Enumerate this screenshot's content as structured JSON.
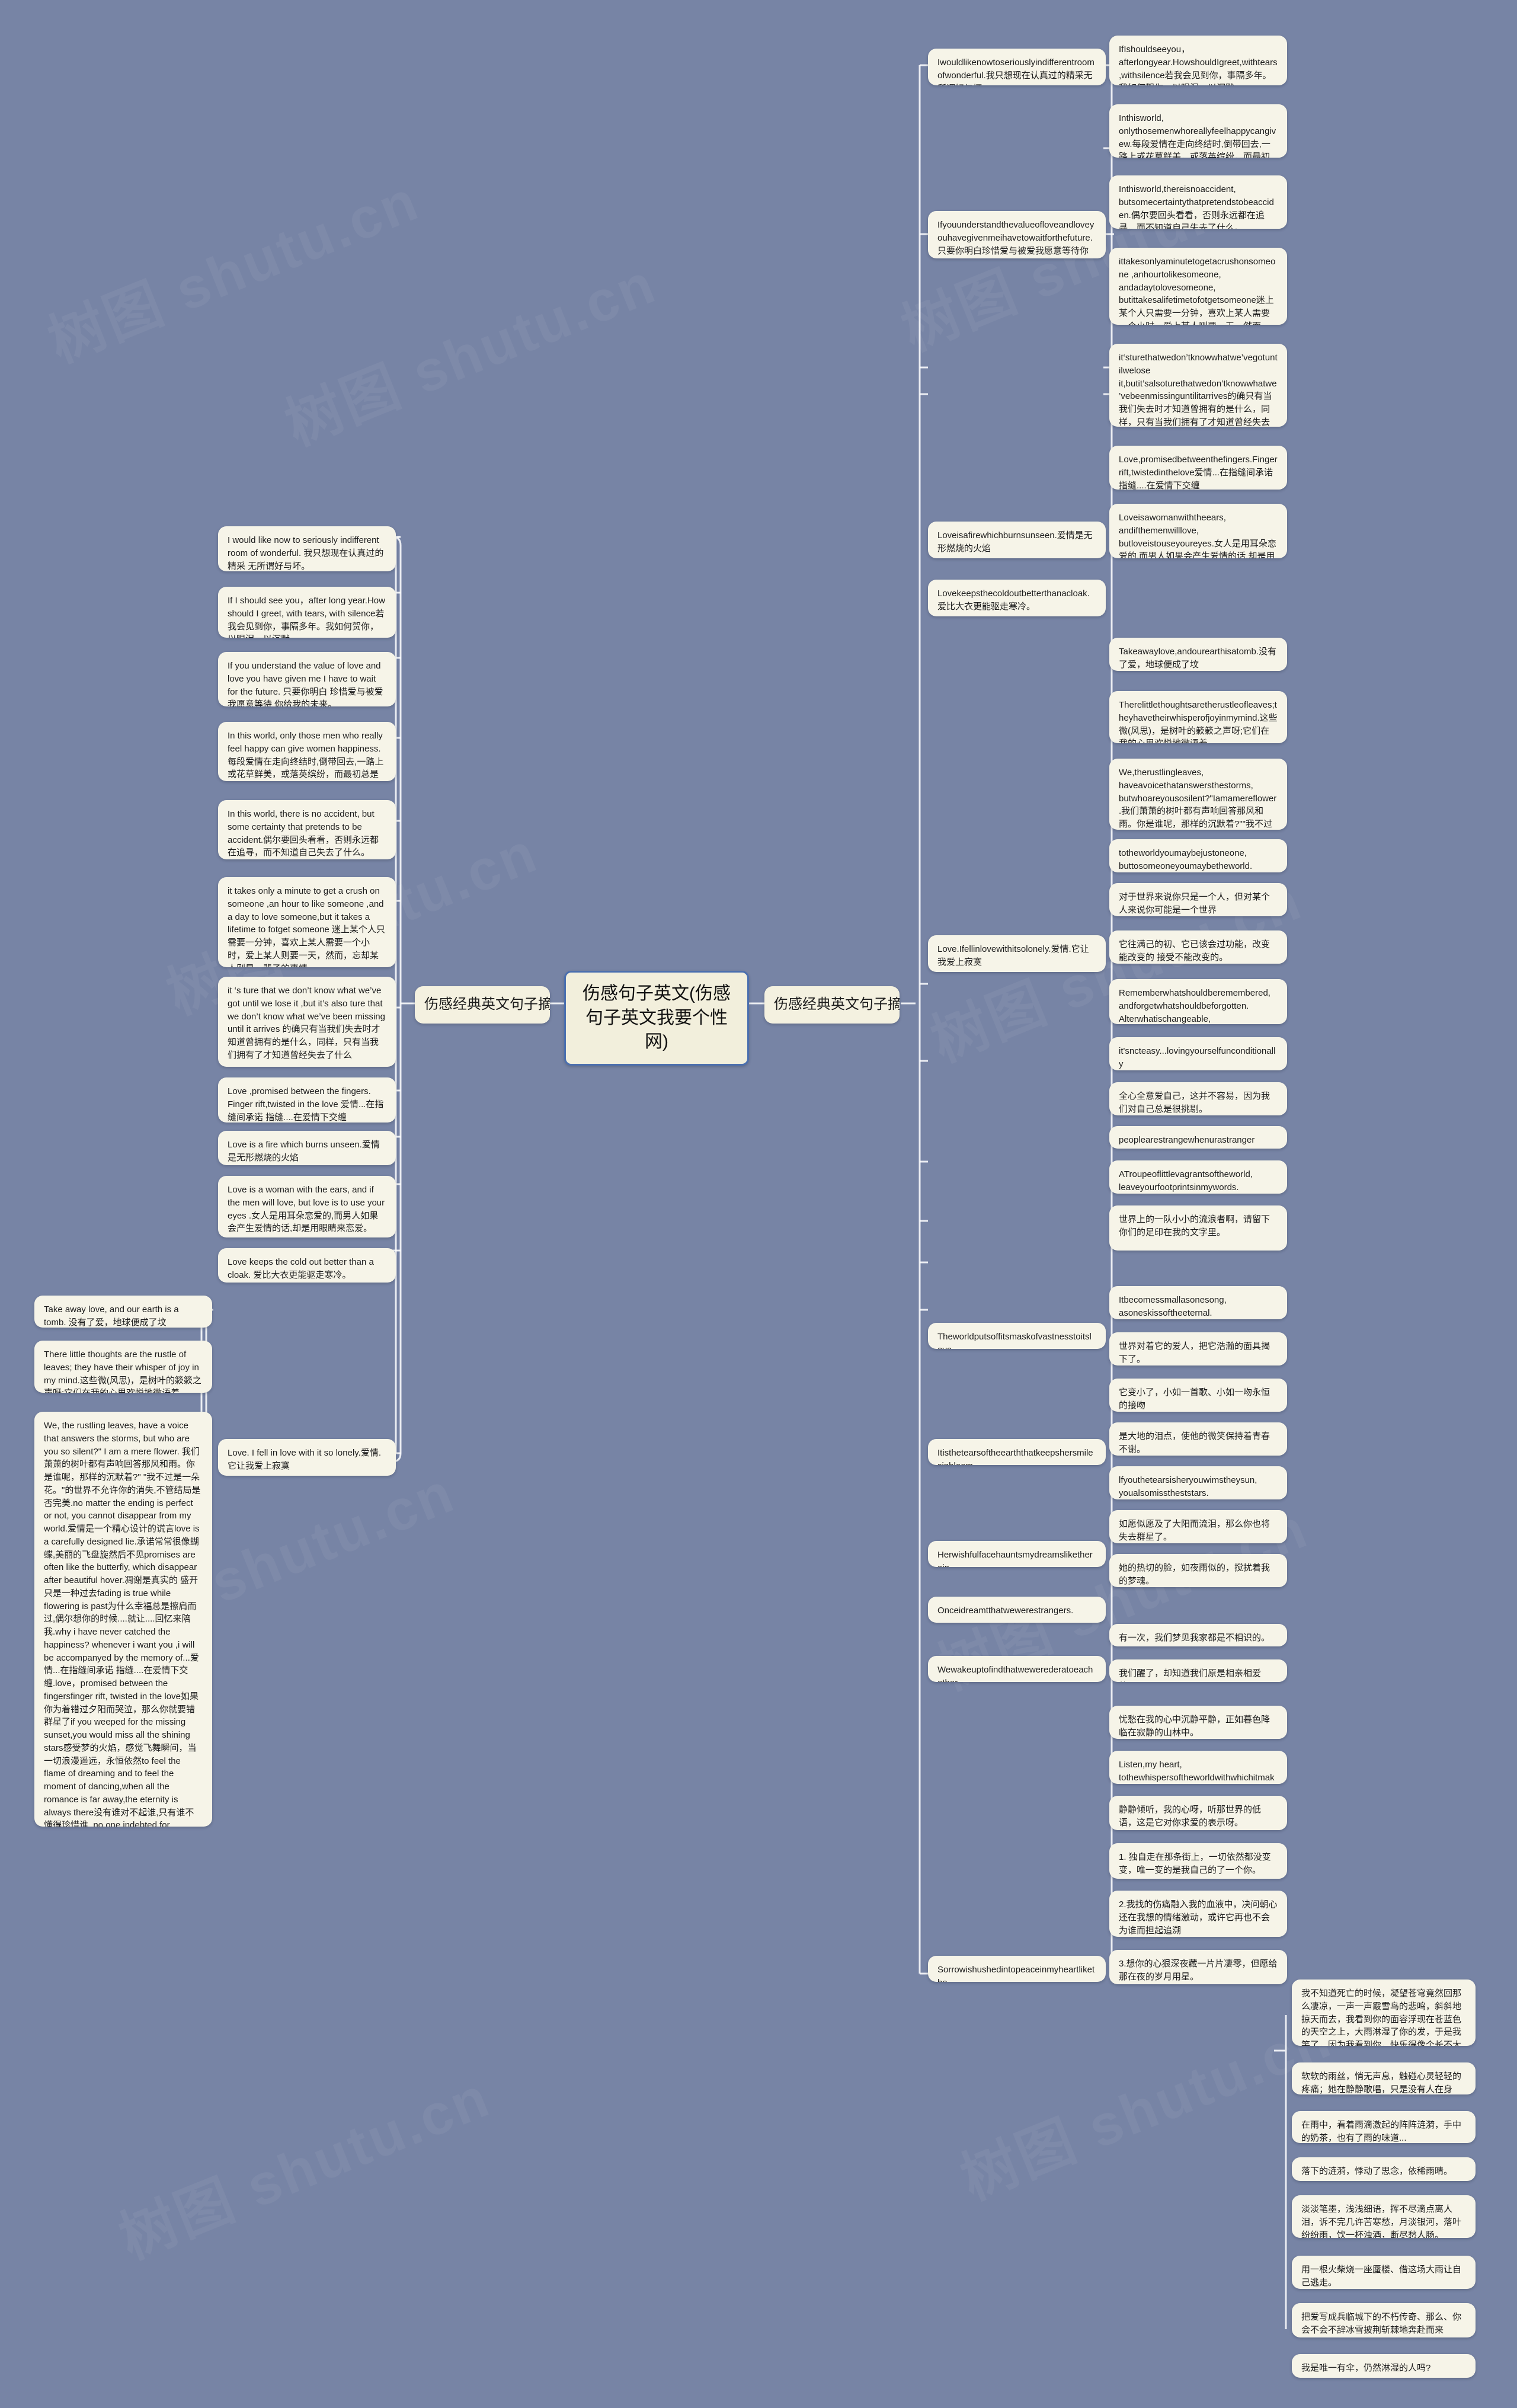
{
  "root": {
    "title": "伤感句子英文(伤感句子英文我要个性网)"
  },
  "branches": {
    "left_label": "伤感经典英文句子摘录：",
    "right_label": "伤感经典英文句子摘录："
  },
  "left_column": [
    {
      "text": "I would like now to seriously indifferent room of wonderful. 我只想现在认真过的精采 无所谓好与坏。"
    },
    {
      "text": "If I should see you，after long year.How should I greet, with tears, with silence若我会见到你，事隔多年。我如何贺你，以眼泪，以沉默。"
    },
    {
      "text": "If you understand the value of love and love you have given me I have to wait for the future. 只要你明白 珍惜爱与被爱 我愿意等待 你给我的未来。"
    },
    {
      "text": "In this world, only those men who really feel happy can give women happiness.每段爱情在走向终结时,倒带回去,一路上或花草鲜美，或落英缤纷，而最初总是倾心的。"
    },
    {
      "text": "In this world, there is no accident, but some certainty that pretends to be accident.偶尔要回头看看，否则永远都在追寻，而不知道自己失去了什么。"
    },
    {
      "text": "it takes only a minute to get a crush on someone ,an hour to like someone ,and a day to love someone,but it takes a lifetime to fotget someone 迷上某个人只需要一分钟，喜欢上某人需要一个小时，爱上某人则要一天，然而，忘却某人则是一辈子的事情"
    },
    {
      "text": "it ‘s ture that we don’t know what we’ve got until we lose it ,but it’s also ture that we don’t know what we’ve been missing until it arrives 的确只有当我们失去时才知道曾拥有的是什么，同样，只有当我们拥有了才知道曾经失去了什么"
    },
    {
      "text": "Love ,promised between the fingers. Finger rift,twisted in the love 爱情...在指缝间承诺 指缝....在爱情下交缠"
    },
    {
      "text": "Love is a fire which burns unseen.爱情是无形燃烧的火焰"
    },
    {
      "text": "Love is a woman with the ears, and if the men will love, but love is to use your eyes .女人是用耳朵恋爱的,而男人如果会产生爱情的话,却是用眼睛来恋爱。"
    },
    {
      "text": "Love keeps the cold out better than a cloak. 爱比大衣更能驱走寒冷。"
    },
    {
      "text": "Love. I fell in love with it so lonely.爱情.它让我爱上寂寞"
    }
  ],
  "far_left_column": [
    {
      "text": "Take away love, and our earth is a tomb. 没有了爱，地球便成了坟"
    },
    {
      "text": "There little thoughts are the rustle of leaves; they have their whisper of joy in my mind.这些微(风思)，是树叶的簌簌之声呀;它们在我的心里欢悦地微语着。"
    },
    {
      "text": "We, the rustling leaves, have a voice that answers the storms, but who are you so silent?\" I am a mere flower. 我们萧萧的树叶都有声响回答那风和雨。你是谁呢，那样的沉默着?\" \"我不过是一朵花。\"的世界不允许你的消失,不管结局是否完美.no matter the ending is perfect or not, you cannot disappear from my world.爱情是一个精心设计的谎言love is a carefully designed lie.承诺常常很像蝴蝶,美丽的飞盘旋然后不见promises are often like the butterfly, which disappear after beautiful hover.凋谢是真实的 盛开只是一种过去fading is true while flowering is past为什么幸福总是擦肩而过,偶尔想你的时候....就让....回忆来陪我.why i have never catched the happiness? whenever i want you ,i will be accompanyed by the memory of...爱情...在指缝间承诺 指缝....在爱情下交缠.love，promised between the fingersfinger rift, twisted in the love如果你为着错过夕阳而哭泣，那么你就要错群星了if you weeped for the missing sunset,you would miss all the shining stars感受梦的火焰，感觉飞舞瞬间，当一切浪漫遥远，永恒依然to feel the flame of dreaming and to feel the moment of dancing,when all the romance is far away,the eternity is always there没有谁对不起谁,只有谁不懂得珍惜谁. no one indebted for others,while many people don't know how to cherish others.永远不是一种距离,而是一种决定。 eternity is not a distance but a decision.在回忆里继续梦幻不如在地狱里等待天堂dreaming in the memory is not as good as waiting for the paradise in the hellwhere there is great love, there are always miracles"
    }
  ],
  "right_mid_column": [
    {
      "text": "Iwouldlikenowtoseriouslyindifferentroomofwonderful.我只想现在认真过的精采无所谓好与坏。"
    },
    {
      "text": "Ifyouunderstandthevalueofloveandloveyouhavegivenmeihavetowaitforthefuture.只要你明白珍惜爱与被爱我愿意等待你给我的未来。"
    },
    {
      "text": "Loveisafirewhichburnsunseen.爱情是无形燃烧的火焰"
    },
    {
      "text": "Lovekeepsthecoldoutbetterthanacloak.爱比大衣更能驱走寒冷。"
    },
    {
      "text": "Love.Ifellinlovewithitsolonely.爱情.它让我爱上寂寞"
    },
    {
      "text": "Theworldputsoffitsmaskofvastnesstoitslove."
    },
    {
      "text": "Itisthetearsoftheearththatkeepshersmilesinbloom."
    },
    {
      "text": "Herwishfulfacehauntsmydreamsliketherain."
    },
    {
      "text": "Onceidreamtthatwewerestrangers."
    },
    {
      "text": "Wewakeuptofindthatwewerederatoeachother."
    },
    {
      "text": "Sorrowishushedintopeaceinmyheartlikethe"
    }
  ],
  "right_far_column": [
    {
      "text": "IfIshouldseeyou，afterlongyear.HowshouldIgreet,withtears,withsilence若我会见到你，事隔多年。我如何贺你，以眼泪，以沉默。"
    },
    {
      "text": "Inthisworld, onlythosemenwhoreallyfeelhappycangivew.每段爱情在走向终结时,倒带回去,一路上或花草鲜美，或落英缤纷，而最初总是倾心的。"
    },
    {
      "text": "Inthisworld,thereisnoaccident, butsomecertaintythatpretendstobeacciden.偶尔要回头看看，否则永远都在追寻，而不知道自己失去了什么。"
    },
    {
      "text": "ittakesonlyaminutetogetacrushonsomeone ,anhourtolikesomeone, andadaytolovesomeone, butittakesalifetimetofotgetsomeone迷上某个人只需要一分钟，喜欢上某人需要一个小时，爱上某人则要一天，然而，忘却某人则是一辈子的事情"
    },
    {
      "text": "it‘sturethatwedon’tknowwhatwe’vegotuntilwelose it,butit’salsoturethatwedon’tknowwhatwe’vebeenmissinguntilitarrives的确只有当我们失去时才知道曾拥有的是什么，同样，只有当我们拥有了才知道曾经失去了什么"
    },
    {
      "text": "Love,promisedbetweenthefingers.Fingerrift,twistedinthelove爱情...在指缝间承诺 指缝....在爱情下交缠"
    },
    {
      "text": "Loveisawomanwiththeears, andifthemenwilllove, butloveistouseyoureyes.女人是用耳朵恋爱的,而男人如果会产生爱情的话,却是用眼睛来恋爱。"
    },
    {
      "text": "Takeawaylove,andourearthisatomb.没有了爱，地球便成了坟"
    },
    {
      "text": "Therelittlethoughtsaretherustleofleaves;theyhavetheirwhisperofjoyinmymind.这些微(风思)，是树叶的簌簌之声呀;它们在我的心里欢悦地微语着。"
    },
    {
      "text": "We,therustlingleaves, haveavoicethatanswersthestorms, butwhoareyousosilent?\"Iamamereflower.我们萧萧的树叶都有声响回答那风和雨。你是谁呢，那样的沉默着?\"\"我不过是一朵花。\""
    },
    {
      "text": "totheworldyoumaybejustoneone, buttosomeoneyoumaybetheworld."
    },
    {
      "text": "对于世界来说你只是一个人，但对某个人来说你可能是一个世界"
    },
    {
      "text": "它往满己的初、它已该会过功能，改变能改变的 接受不能改变的。"
    },
    {
      "text": "Rememberwhatshouldberemembered, andforgetwhatshouldbeforgotten. Alterwhatischangeable, andacceptwhatisimmutable."
    },
    {
      "text": "it'sncteasy...lovingyourselfunconditionally ,becausewe'velearnedtojudgeourselves..."
    },
    {
      "text": "全心全意爱自己，这并不容易，因为我们对自己总是很挑剔。"
    },
    {
      "text": "peoplearestrangewhenurastranger"
    },
    {
      "text": "ATroupeoflittlevagrantsoftheworld, leaveyourfootprintsinmywords."
    },
    {
      "text": "世界上的一队小小的流浪者啊，请留下你们的足印在我的文字里。"
    },
    {
      "text": "Itbecomessmallasonesong, asoneskissoftheeternal."
    },
    {
      "text": "世界对着它的爱人，把它浩瀚的面具揭下了。"
    },
    {
      "text": "它变小了，小如一首歌、小如一吻永恒的接吻"
    },
    {
      "text": "是大地的泪点，使他的微笑保持着青春不谢。"
    },
    {
      "text": "lfyouthetearsisheryouwimstheysun, youalsomisstheststars."
    },
    {
      "text": "如愿似愿及了大阳而流泪，那么你也将失去群星了。"
    },
    {
      "text": "她的热切的脸，如夜雨似的，搅扰着我的梦魂。"
    },
    {
      "text": "有一次，我们梦见我家都是不相识的。"
    },
    {
      "text": "我们醒了，却知道我们原是相亲相爱的。"
    },
    {
      "text": "忧愁在我的心中沉静平静，正如暮色降临在寂静的山林中。"
    },
    {
      "text": "Listen,my heart, tothewhispersoftheworldwithwhichitmakes"
    },
    {
      "text": "静静倾听，我的心呀，听那世界的低语，这是它对你求爱的表示呀。"
    },
    {
      "text": "1. 独自走在那条街上，一切依然都没变变，唯一变的是我自己的了一个你。"
    },
    {
      "text": "2.我找的伤痛融入我的血液中，决问朝心还在我想的情绪激动，或许它再也不会为谁而担起追溯"
    },
    {
      "text": "3.想你的心狠深夜藏一片片凄零，但愿给那在夜的岁月用星。"
    }
  ],
  "bottom_right_column": [
    {
      "text": "我不知道死亡的时候，凝望苍穹竟然回那么凄凉，一声一声霰雪鸟的悲鸣，斜斜地掠天而去，我看到你的面容浮现在苍蓝色的天空之上，大雨淋湿了你的发，于是我笑了，因为我看到你，快乐得像个长不大的孩子。"
    },
    {
      "text": "软软的雨丝，悄无声息，触碰心灵轻轻的疼痛；她在静静歌唱，只是没有人在身旁............"
    },
    {
      "text": "在雨中，看着雨滴激起的阵阵涟漪，手中的奶茶，也有了雨的味道..."
    },
    {
      "text": "落下的涟漪，悸动了思念，依稀雨晴。"
    },
    {
      "text": "淡淡笔墨，浅浅细语，挥不尽滴点离人泪，诉不完几许苦寒愁，月淡银河，落叶纷纷雨，饮一杯浊酒，断尽愁人肠。"
    },
    {
      "text": "用一根火柴烧一座蜃楼、借这场大雨让自己逃走。"
    },
    {
      "text": "把爱写成兵临城下的不朽传奇、那么、你会不会不辞冰雪披荆斩棘地奔赴而来"
    },
    {
      "text": "我是唯一有伞，仍然淋湿的人吗?"
    }
  ],
  "watermark": {
    "text": "树图 shutu.cn"
  },
  "colors": {
    "background": "#7784a5",
    "node_bg": "#f6f4e8",
    "root_border": "#4b6fae",
    "connector": "#ffffff",
    "text": "#1d1d1d"
  }
}
